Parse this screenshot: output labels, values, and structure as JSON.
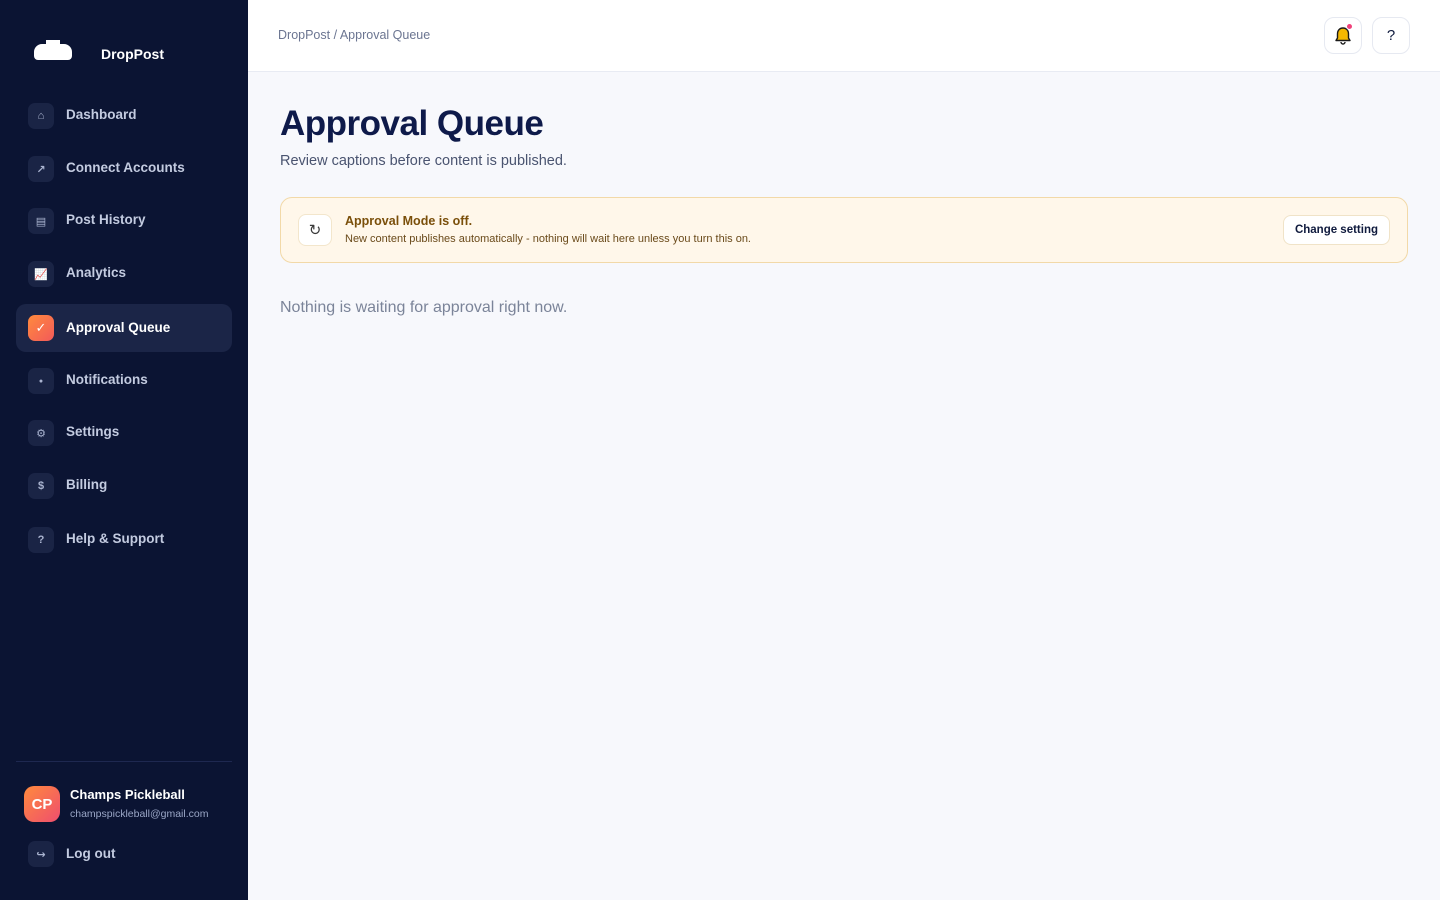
{
  "brand": {
    "name": "DropPost",
    "logo_icon": "cloud-icon"
  },
  "sidebar": {
    "items": [
      {
        "label": "Dashboard",
        "icon": "home-icon",
        "glyph": "⌂"
      },
      {
        "label": "Connect Accounts",
        "icon": "arrow-icon",
        "glyph": "↗"
      },
      {
        "label": "Post History",
        "icon": "list-icon",
        "glyph": "▤"
      },
      {
        "label": "Analytics",
        "icon": "chart-icon",
        "glyph": "📈"
      },
      {
        "label": "Approval Queue",
        "icon": "check-icon",
        "glyph": "✓",
        "active": true
      },
      {
        "label": "Notifications",
        "icon": "dot-icon",
        "glyph": "●"
      },
      {
        "label": "Settings",
        "icon": "gear-icon",
        "glyph": "⚙"
      },
      {
        "label": "Billing",
        "icon": "dollar-icon",
        "glyph": "$"
      },
      {
        "label": "Help & Support",
        "icon": "question-icon",
        "glyph": "?"
      }
    ],
    "user": {
      "initials": "CP",
      "name": "Champs Pickleball",
      "email": "champspickleball@gmail.com"
    },
    "logout": {
      "label": "Log out",
      "icon": "logout-icon",
      "glyph": "↪"
    }
  },
  "header": {
    "breadcrumb": "DropPost / Approval Queue",
    "help_glyph": "?"
  },
  "main": {
    "title": "Approval Queue",
    "subtitle": "Review captions before content is published.",
    "banner": {
      "icon_glyph": "↻",
      "title": "Approval Mode is off.",
      "text": "New content publishes automatically - nothing will wait here unless you turn this on.",
      "button": "Change setting"
    },
    "empty_message": "Nothing is waiting for approval right now."
  },
  "colors": {
    "sidebar_bg": "#0b1433",
    "accent": "#ff8a3d",
    "title": "#0e1a4a",
    "banner_bg": "#fff7ea",
    "notification_dot": "#f0417a"
  }
}
